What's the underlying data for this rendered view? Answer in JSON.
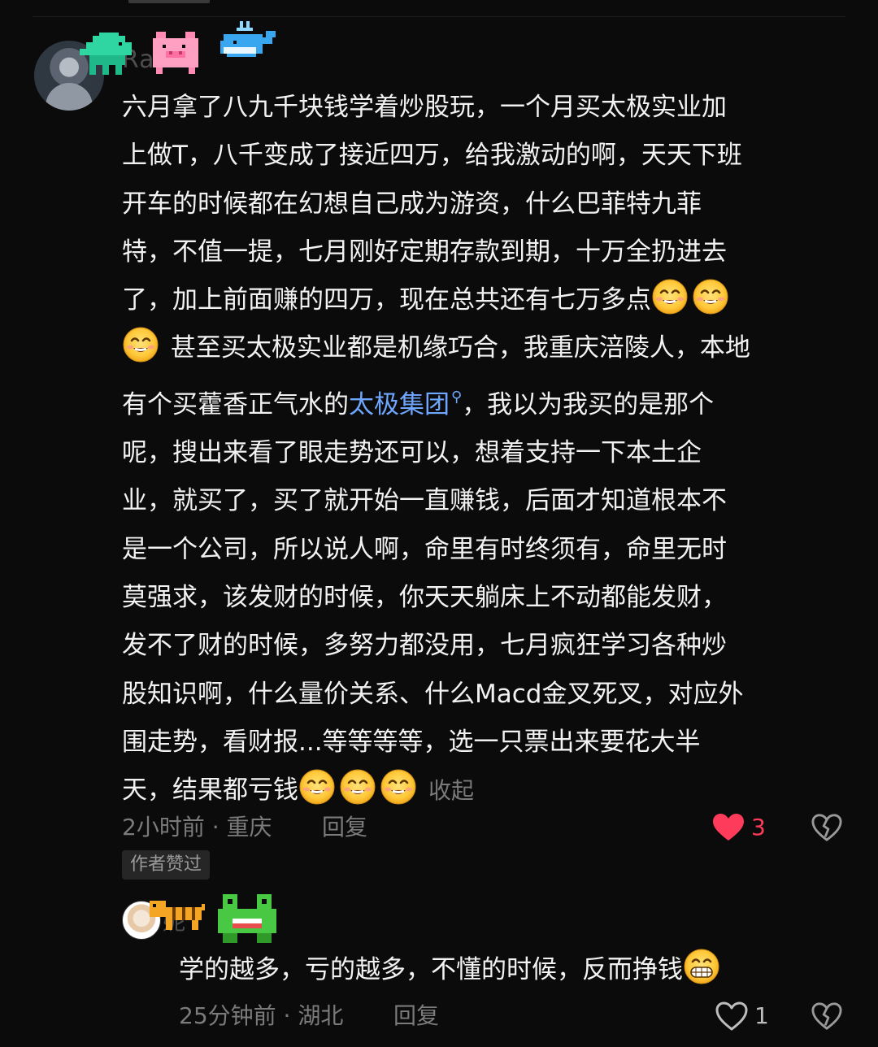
{
  "comment": {
    "username": "Ra",
    "lines": [
      "六月拿了八九千块钱学着炒股玩，一个月买太极实业加",
      "上做T，八千变成了接近四万，给我激动的啊，天天下班",
      "开车的时候都在幻想自己成为游资，什么巴菲特九菲",
      "特，不值一提，七月刚好定期存款到期，十万全扔进去",
      "了，加上前面赚的四万，现在总共还有七万多点",
      "甚至买太极实业都是机缘巧合，我重庆涪陵人，本地",
      "有个买藿香正气水的",
      "太极集团",
      "，我以为我买的是那个",
      "呢，搜出来看了眼走势还可以，想着支持一下本土企",
      "业，就买了，买了就开始一直赚钱，后面才知道根本不",
      "是一个公司，所以说人啊，命里有时终须有，命里无时",
      "莫强求，该发财的时候，你天天躺床上不动都能发财，",
      "发不了财的时候，多努力都没用，七月疯狂学习各种炒",
      "股知识啊，什么量价关系、什么Macd金叉死叉，对应外",
      "围走势，看财报...等等等等，选一只票出来要花大半",
      "天，结果都亏钱"
    ],
    "collapse_label": "收起",
    "time_location": "2小时前 · 重庆",
    "reply_label": "回复",
    "like_count": "3",
    "author_badge": "作者赞过",
    "emoji": "smiling-face-icon"
  },
  "reply": {
    "username": "妮",
    "text": "学的越多，亏的越多，不懂的时候，反而挣钱",
    "time_location": "25分钟前 · 湖北",
    "reply_label": "回复",
    "like_count": "1"
  },
  "colors": {
    "background": "#0b0b0b",
    "text": "#f2f2f2",
    "muted": "#7b7b7b",
    "link": "#6fa6ff",
    "liked": "#ff3b5c"
  }
}
